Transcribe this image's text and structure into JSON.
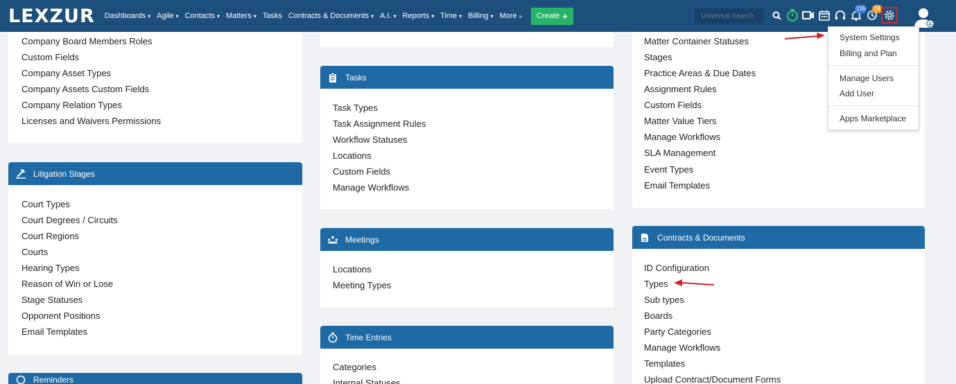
{
  "header": {
    "logo": "LEXZUR",
    "nav": [
      {
        "label": "Dashboards"
      },
      {
        "label": "Agile"
      },
      {
        "label": "Contacts"
      },
      {
        "label": "Matters"
      },
      {
        "label": "Tasks",
        "no_caret": true
      },
      {
        "label": "Contracts & Documents"
      },
      {
        "label": "A.I."
      },
      {
        "label": "Reports"
      },
      {
        "label": "Time"
      },
      {
        "label": "Billing"
      },
      {
        "label": "More"
      }
    ],
    "create_label": "Create",
    "search_placeholder": "Universal Search",
    "badges": {
      "notifications": "116",
      "reminders": "24"
    },
    "icons": [
      "search-icon",
      "timer-icon",
      "video-icon",
      "calendar-icon",
      "headset-icon",
      "bell-icon",
      "reminder-icon",
      "gear-icon",
      "user-avatar-icon"
    ]
  },
  "settings_menu": {
    "items": [
      "System Settings",
      "Billing and Plan",
      "Manage Users",
      "Add User",
      "Apps Marketplace"
    ]
  },
  "companies_panel": {
    "items": [
      "Company Board Members Roles",
      "Custom Fields",
      "Company Asset Types",
      "Company Assets Custom Fields",
      "Company Relation Types",
      "Licenses and Waivers Permissions"
    ]
  },
  "litigation_panel": {
    "title": "Litigation Stages",
    "items": [
      "Court Types",
      "Court Degrees / Circuits",
      "Court Regions",
      "Courts",
      "Hearing Types",
      "Reason of Win or Lose",
      "Stage Statuses",
      "Opponent Positions",
      "Email Templates"
    ]
  },
  "reminders_panel": {
    "title": "Reminders"
  },
  "tasks_panel": {
    "title": "Tasks",
    "items": [
      "Task Types",
      "Task Assignment Rules",
      "Workflow Statuses",
      "Locations",
      "Custom Fields",
      "Manage Workflows"
    ]
  },
  "meetings_panel": {
    "title": "Meetings",
    "items": [
      "Locations",
      "Meeting Types"
    ]
  },
  "time_entries_panel": {
    "title": "Time Entries",
    "items": [
      "Categories",
      "Internal Statuses"
    ]
  },
  "matters_panel": {
    "items": [
      "Matter Container Statuses",
      "Stages",
      "Practice Areas & Due Dates",
      "Assignment Rules",
      "Custom Fields",
      "Matter Value Tiers",
      "Manage Workflows",
      "SLA Management",
      "Event Types",
      "Email Templates"
    ]
  },
  "contracts_panel": {
    "title": "Contracts & Documents",
    "items": [
      "ID Configuration",
      "Types",
      "Sub types",
      "Boards",
      "Party Categories",
      "Manage Workflows",
      "Templates",
      "Upload Contract/Document Forms"
    ]
  },
  "colors": {
    "nav": "#1d4f7c",
    "panel_header": "#1f6aa5",
    "create": "#28b36a",
    "highlight": "#e02020"
  }
}
